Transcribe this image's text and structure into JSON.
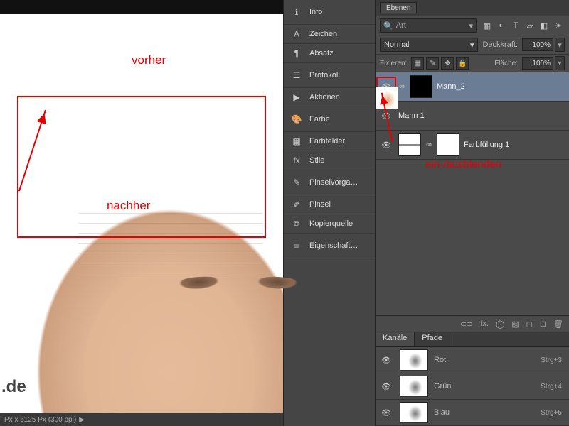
{
  "canvas": {
    "label_before": "vorher",
    "label_after": "nachher",
    "watermark": ".de",
    "status": "Px x 5125 Px (300 ppi)",
    "status_chevron": "▶"
  },
  "iconpanel": {
    "items": [
      {
        "icon": "ℹ",
        "label": "Info"
      },
      {
        "icon": "A",
        "label": "Zeichen"
      },
      {
        "icon": "¶",
        "label": "Absatz"
      },
      {
        "icon": "☰",
        "label": "Protokoll"
      },
      {
        "icon": "▶",
        "label": "Aktionen"
      },
      {
        "icon": "🎨",
        "label": "Farbe"
      },
      {
        "icon": "▦",
        "label": "Farbfelder"
      },
      {
        "icon": "fx",
        "label": "Stile"
      },
      {
        "icon": "✎",
        "label": "Pinselvorga…"
      },
      {
        "icon": "✐",
        "label": "Pinsel"
      },
      {
        "icon": "⧉",
        "label": "Kopierquelle"
      },
      {
        "icon": "≡",
        "label": "Eigenschaft…"
      }
    ]
  },
  "layers_panel": {
    "tab": "Ebenen",
    "search_icon": "🔍",
    "search_text": "Art",
    "search_chev": "▾",
    "toolbar_icons": [
      "▦",
      "◐",
      "T",
      "▱",
      "◧",
      "☀"
    ],
    "blend": "Normal",
    "opacity_label": "Deckkraft:",
    "opacity": "100%",
    "fix_label": "Fixieren:",
    "fill_label": "Fläche:",
    "fill": "100%",
    "lock_icons": [
      "▦",
      "✎",
      "✥",
      "🔒"
    ],
    "layers": [
      {
        "name": "Mann_2",
        "mask": true,
        "selected": true,
        "highlight": true
      },
      {
        "name": "Mann 1",
        "mask": false,
        "selected": false
      },
      {
        "name": "Farbfüllung 1",
        "mask": false,
        "selected": false,
        "fill": true
      }
    ],
    "annotation": "ein-/ausblenden",
    "footer_icons": [
      "⊂⊃",
      "fx.",
      "◯",
      "▧",
      "◻",
      "⊞",
      "🗑"
    ]
  },
  "channels_panel": {
    "tabs": [
      "Kanäle",
      "Pfade"
    ],
    "channels": [
      {
        "name": "Rot",
        "shortcut": "Strg+3"
      },
      {
        "name": "Grün",
        "shortcut": "Strg+4"
      },
      {
        "name": "Blau",
        "shortcut": "Strg+5"
      }
    ]
  },
  "eye_glyph": "👁"
}
